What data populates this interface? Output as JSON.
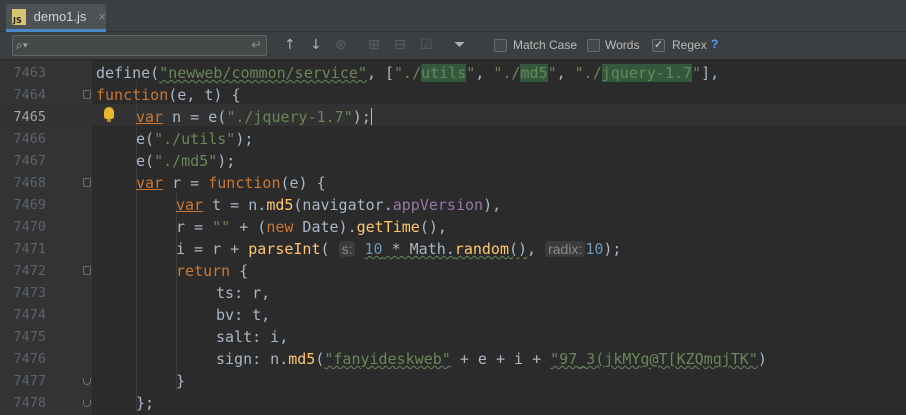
{
  "tab": {
    "label": "demo1.js",
    "icon_text": "JS",
    "close": "×"
  },
  "find": {
    "query": "",
    "placeholder": "",
    "match_case_label": "Match Case",
    "words_label": "Words",
    "regex_label": "Regex",
    "help": "?",
    "match_case_checked": false,
    "words_checked": false,
    "regex_checked": true
  },
  "editor": {
    "current_line": "7465",
    "lines": [
      {
        "number": "7463"
      },
      {
        "number": "7464"
      },
      {
        "number": "7465"
      },
      {
        "number": "7466"
      },
      {
        "number": "7467"
      },
      {
        "number": "7468"
      },
      {
        "number": "7469"
      },
      {
        "number": "7470"
      },
      {
        "number": "7471"
      },
      {
        "number": "7472"
      },
      {
        "number": "7473"
      },
      {
        "number": "7474"
      },
      {
        "number": "7475"
      },
      {
        "number": "7476"
      },
      {
        "number": "7477"
      },
      {
        "number": "7478"
      }
    ],
    "t": {
      "define": "define(",
      "s_newweb": "\"newweb/common/service\"",
      "comma_br": ", [",
      "q1": "\"./",
      "utils": "utils",
      "q2": "\"",
      "sep": ", ",
      "md5": "md5",
      "jq": "jquery-1.7",
      "close_br": "],",
      "function": "function",
      "l1_rest": "(e, t) {",
      "var": "var",
      "n_assign": " n = e(",
      "s_jq": "\"./jquery-1.7\"",
      "semi_close": ");",
      "e_open": "e(",
      "s_utils": "\"./utils\"",
      "s_md5": "\"./md5\"",
      "r_assign": " r = ",
      "fn_e": "(e) {",
      "t_assign": " t = n.",
      "md5_fn": "md5",
      "navigator": "(navigator.",
      "appVersion": "appVersion",
      "close_comma": "),",
      "r_eq": "r = ",
      "empty_str": "\"\"",
      "plus_open": " + (",
      "new": "new",
      "date": " Date).",
      "getTime": "getTime",
      "paren_comma": "(),",
      "i_eq": "i = r + ",
      "parseInt": "parseInt",
      "paren_open": "( ",
      "hint_s": "s:",
      "sp": " ",
      "ten": "10",
      "mul_math": " * Math.",
      "random": "random",
      "paren_close": "()",
      "comma_sp": ", ",
      "hint_radix": "radix:",
      "ten2": "10",
      "end_semi": ");",
      "return": "return",
      "brace_open": " {",
      "ts": "ts",
      "ts_val": ": r,",
      "bv": "bv",
      "bv_val": ": t,",
      "salt": "salt",
      "salt_val": ": i,",
      "sign": "sign",
      "sign_pre": ": n.",
      "sign_open": "(",
      "fanyi": "\"fanyideskweb\"",
      "sign_mid": " + e + i + ",
      "salt_str": "\"97_3(jkMYg@T[KZQmqjTK\"",
      "sign_close": ")",
      "brace_close": "}",
      "end_brace": "};"
    }
  }
}
